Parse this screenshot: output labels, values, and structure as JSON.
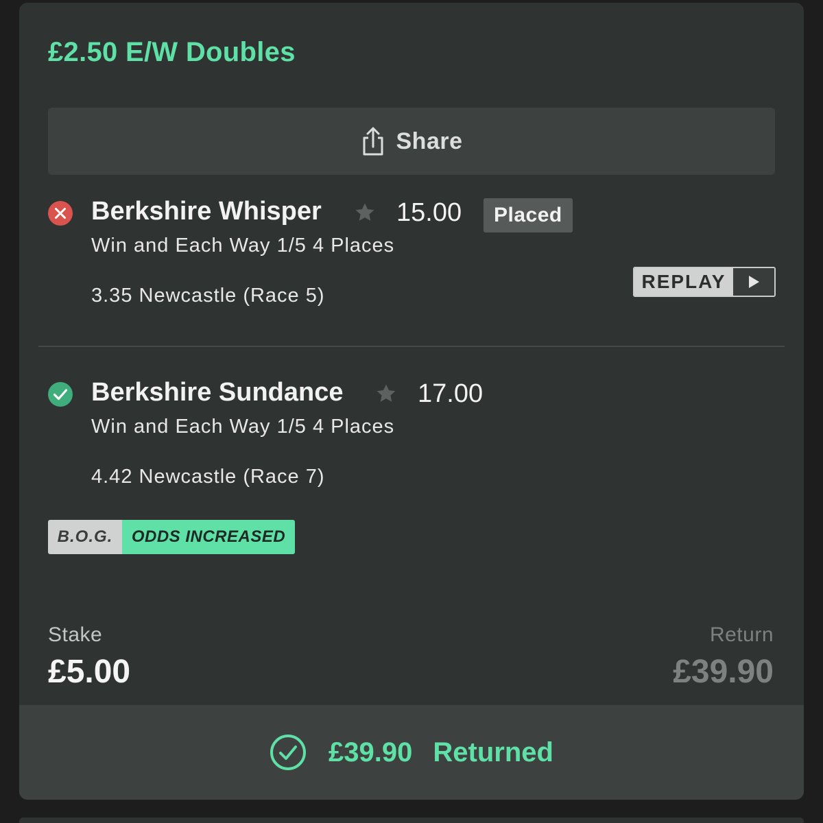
{
  "card": {
    "title": "£2.50 E/W Doubles",
    "share_label": "Share"
  },
  "selections": [
    {
      "name": "Berkshire Whisper",
      "odds": "15.00",
      "badge": "Placed",
      "market": "Win and Each Way 1/5 4 Places",
      "race": "3.35 Newcastle (Race 5)",
      "status": "lost",
      "status_icon": "x-circle-icon",
      "replay_label": "REPLAY"
    },
    {
      "name": "Berkshire Sundance",
      "odds": "17.00",
      "market": "Win and Each Way 1/5 4 Places",
      "race": "4.42 Newcastle (Race 7)",
      "status": "won",
      "status_icon": "check-circle-icon",
      "promo": {
        "left": "B.O.G.",
        "right": "ODDS INCREASED"
      }
    }
  ],
  "summary": {
    "stake_label": "Stake",
    "stake_value": "£5.00",
    "return_label": "Return",
    "return_value": "£39.90"
  },
  "footer": {
    "amount": "£39.90",
    "label": "Returned"
  },
  "colors": {
    "accent_green": "#5ee0a7",
    "lost_red": "#d9534f",
    "won_green": "#3fae7c",
    "card_bg": "#2f3331",
    "page_bg": "#1c1d1c"
  }
}
